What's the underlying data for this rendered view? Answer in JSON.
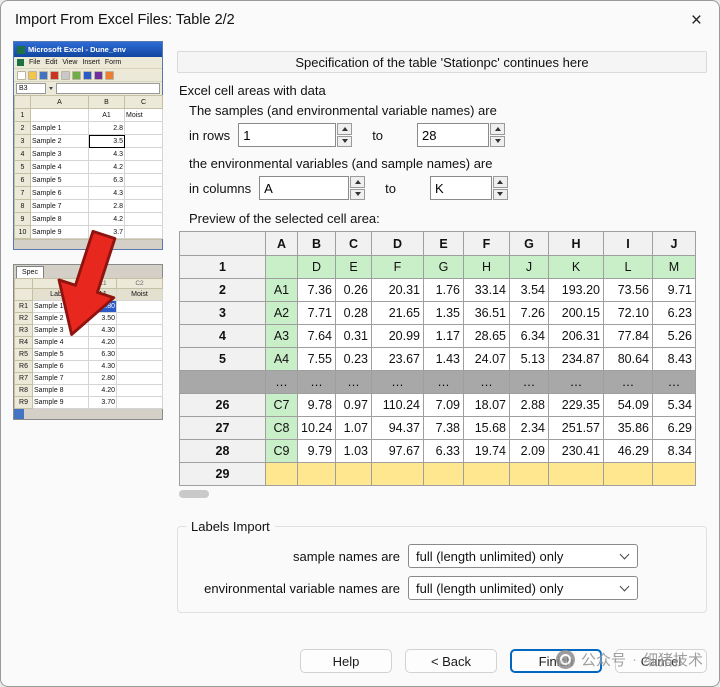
{
  "dialog": {
    "title": "Import From Excel Files: Table 2/2",
    "close_glyph": "×"
  },
  "banner": {
    "text": "Specification of the table 'Stationpc' continues here"
  },
  "cell_areas": {
    "group_title": "Excel cell areas with data",
    "samples_line": "The samples (and environmental variable names) are",
    "rows_label": "in rows",
    "to_label": "to",
    "rows_from": "1",
    "rows_to": "28",
    "env_line": "the environmental variables (and sample names) are",
    "cols_label": "in columns",
    "cols_from": "A",
    "cols_to": "K"
  },
  "preview": {
    "label": "Preview of the selected cell area:",
    "col_headers": [
      "A",
      "B",
      "C",
      "D",
      "E",
      "F",
      "G",
      "H",
      "I",
      "J"
    ],
    "rows": [
      {
        "label": "1",
        "type": "names",
        "cells": [
          "",
          "D",
          "E",
          "F",
          "G",
          "H",
          "J",
          "K",
          "L",
          "M"
        ]
      },
      {
        "label": "2",
        "type": "data",
        "cells": [
          "A1",
          "7.36",
          "0.26",
          "20.31",
          "1.76",
          "33.14",
          "3.54",
          "193.20",
          "73.56",
          "9.71"
        ]
      },
      {
        "label": "3",
        "type": "data",
        "cells": [
          "A2",
          "7.71",
          "0.28",
          "21.65",
          "1.35",
          "36.51",
          "7.26",
          "200.15",
          "72.10",
          "6.23"
        ]
      },
      {
        "label": "4",
        "type": "data",
        "cells": [
          "A3",
          "7.64",
          "0.31",
          "20.99",
          "1.17",
          "28.65",
          "6.34",
          "206.31",
          "77.84",
          "5.26"
        ]
      },
      {
        "label": "5",
        "type": "data",
        "cells": [
          "A4",
          "7.55",
          "0.23",
          "23.67",
          "1.43",
          "24.07",
          "5.13",
          "234.87",
          "80.64",
          "8.43"
        ]
      },
      {
        "label": "",
        "type": "ellipsis",
        "cells": [
          "…",
          "…",
          "…",
          "…",
          "…",
          "…",
          "…",
          "…",
          "…",
          "…"
        ]
      },
      {
        "label": "26",
        "type": "data",
        "cells": [
          "C7",
          "9.78",
          "0.97",
          "110.24",
          "7.09",
          "18.07",
          "2.88",
          "229.35",
          "54.09",
          "5.34"
        ]
      },
      {
        "label": "27",
        "type": "data",
        "cells": [
          "C8",
          "10.24",
          "1.07",
          "94.37",
          "7.38",
          "15.68",
          "2.34",
          "251.57",
          "35.86",
          "6.29"
        ]
      },
      {
        "label": "28",
        "type": "data",
        "cells": [
          "C9",
          "9.79",
          "1.03",
          "97.67",
          "6.33",
          "19.74",
          "2.09",
          "230.41",
          "46.29",
          "8.34"
        ]
      },
      {
        "label": "29",
        "type": "empty",
        "cells": [
          "",
          "",
          "",
          "",
          "",
          "",
          "",
          "",
          "",
          ""
        ]
      }
    ]
  },
  "labels_import": {
    "group_title": "Labels Import",
    "sample_label": "sample names are",
    "sample_value": "full (length unlimited) only",
    "env_label": "environmental variable names are",
    "env_value": "full (length unlimited) only"
  },
  "footer": {
    "help": "Help",
    "back": "< Back",
    "finish": "Finish",
    "cancel": "Cancel"
  },
  "watermark": {
    "text1": "公众号",
    "separator": "·",
    "text2": "细猪技术"
  },
  "excel_thumb": {
    "title": "Microsoft Excel - Dune_env",
    "menu_items": [
      "File",
      "Edit",
      "View",
      "Insert",
      "Form"
    ],
    "name_box": "B3",
    "top_sheet": {
      "col_headers": [
        "A",
        "B",
        "C"
      ],
      "rows": [
        {
          "n": "1",
          "a": "",
          "b": "A1",
          "c": "Moist",
          "hdr": true
        },
        {
          "n": "2",
          "a": "Sample 1",
          "b": "2.8",
          "c": ""
        },
        {
          "n": "3",
          "a": "Sample 2",
          "b": "3.5",
          "c": "",
          "sel": true
        },
        {
          "n": "4",
          "a": "Sample 3",
          "b": "4.3",
          "c": ""
        },
        {
          "n": "5",
          "a": "Sample 4",
          "b": "4.2",
          "c": ""
        },
        {
          "n": "6",
          "a": "Sample 5",
          "b": "6.3",
          "c": ""
        },
        {
          "n": "7",
          "a": "Sample 6",
          "b": "4.3",
          "c": ""
        },
        {
          "n": "8",
          "a": "Sample 7",
          "b": "2.8",
          "c": ""
        },
        {
          "n": "9",
          "a": "Sample 8",
          "b": "4.2",
          "c": ""
        },
        {
          "n": "10",
          "a": "Sample 9",
          "b": "3.7",
          "c": ""
        }
      ]
    },
    "spec_tab": "Spec",
    "bottom_sheet": {
      "col_refs": [
        "C1",
        "C2"
      ],
      "header": {
        "label": "Labels",
        "b": "A1",
        "c": "Moist"
      },
      "rows": [
        {
          "n": "R1",
          "a": "Sample 1",
          "b": "2.80",
          "sel": true
        },
        {
          "n": "R2",
          "a": "Sample 2",
          "b": "3.50"
        },
        {
          "n": "R3",
          "a": "Sample 3",
          "b": "4.30"
        },
        {
          "n": "R4",
          "a": "Sample 4",
          "b": "4.20"
        },
        {
          "n": "R5",
          "a": "Sample 5",
          "b": "6.30"
        },
        {
          "n": "R6",
          "a": "Sample 6",
          "b": "4.30"
        },
        {
          "n": "R7",
          "a": "Sample 7",
          "b": "2.80"
        },
        {
          "n": "R8",
          "a": "Sample 8",
          "b": "4.20"
        },
        {
          "n": "R9",
          "a": "Sample 9",
          "b": "3.70"
        }
      ]
    }
  }
}
